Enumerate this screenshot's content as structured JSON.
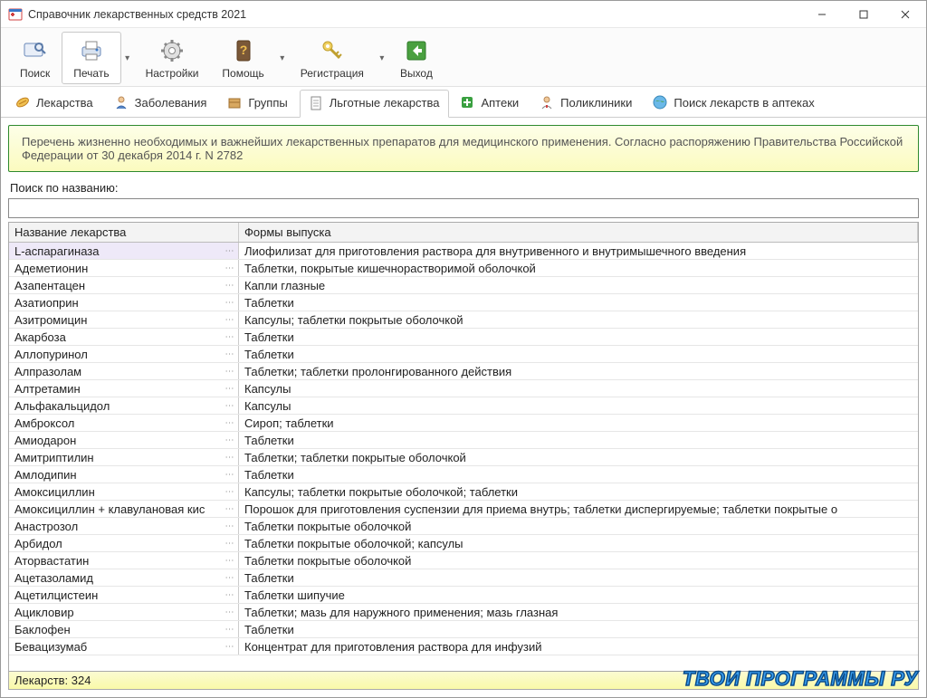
{
  "app": {
    "title": "Справочник лекарственных средств 2021"
  },
  "toolbar": {
    "search": "Поиск",
    "print": "Печать",
    "settings": "Настройки",
    "help": "Помощь",
    "register": "Регистрация",
    "exit": "Выход"
  },
  "tabs": {
    "drugs": "Лекарства",
    "diseases": "Заболевания",
    "groups": "Группы",
    "preferential": "Льготные лекарства",
    "pharmacies": "Аптеки",
    "clinics": "Поликлиники",
    "find_in_pharm": "Поиск лекарств в аптеках"
  },
  "banner": "Перечень жизненно необходимых и важнейших лекарственных препаратов для медицинского применения. Согласно распоряжению Правительства Российской Федерации от 30 декабря 2014 г. N 2782",
  "search": {
    "label": "Поиск по названию:",
    "value": ""
  },
  "columns": {
    "name": "Название лекарства",
    "form": "Формы выпуска"
  },
  "rows": [
    {
      "name": "L-аспарагиназа",
      "form": "Лиофилизат для приготовления раствора для внутривенного и внутримышечного введения"
    },
    {
      "name": "Адеметионин",
      "form": "Таблетки, покрытые кишечнорастворимой оболочкой"
    },
    {
      "name": "Азапентацен",
      "form": "Капли глазные"
    },
    {
      "name": "Азатиоприн",
      "form": "Таблетки"
    },
    {
      "name": "Азитромицин",
      "form": "Капсулы; таблетки покрытые оболочкой"
    },
    {
      "name": "Акарбоза",
      "form": "Таблетки"
    },
    {
      "name": "Аллопуринол",
      "form": "Таблетки"
    },
    {
      "name": "Алпразолам",
      "form": "Таблетки; таблетки пролонгированного действия"
    },
    {
      "name": "Алтретамин",
      "form": "Капсулы"
    },
    {
      "name": "Альфакальцидол",
      "form": "Капсулы"
    },
    {
      "name": "Амброксол",
      "form": "Сироп; таблетки"
    },
    {
      "name": "Амиодарон",
      "form": "Таблетки"
    },
    {
      "name": "Амитриптилин",
      "form": "Таблетки; таблетки покрытые оболочкой"
    },
    {
      "name": "Амлодипин",
      "form": "Таблетки"
    },
    {
      "name": "Амоксициллин",
      "form": "Капсулы; таблетки покрытые оболочкой; таблетки"
    },
    {
      "name": "Амоксициллин + клавулановая кис",
      "form": "Порошок для приготовления суспензии для приема внутрь; таблетки диспергируемые; таблетки покрытые о"
    },
    {
      "name": "Анастрозол",
      "form": "Таблетки покрытые оболочкой"
    },
    {
      "name": "Арбидол",
      "form": "Таблетки покрытые оболочкой; капсулы"
    },
    {
      "name": "Аторвастатин",
      "form": "Таблетки покрытые оболочкой"
    },
    {
      "name": "Ацетазоламид",
      "form": "Таблетки"
    },
    {
      "name": "Ацетилцистеин",
      "form": "Таблетки шипучие"
    },
    {
      "name": "Ацикловир",
      "form": "Таблетки; мазь для наружного применения; мазь глазная"
    },
    {
      "name": "Баклофен",
      "form": "Таблетки"
    },
    {
      "name": "Бевацизумаб",
      "form": "Концентрат для приготовления раствора для инфузий"
    }
  ],
  "status": "Лекарств: 324",
  "watermark": "ТВОИ ПРОГРАММЫ РУ"
}
